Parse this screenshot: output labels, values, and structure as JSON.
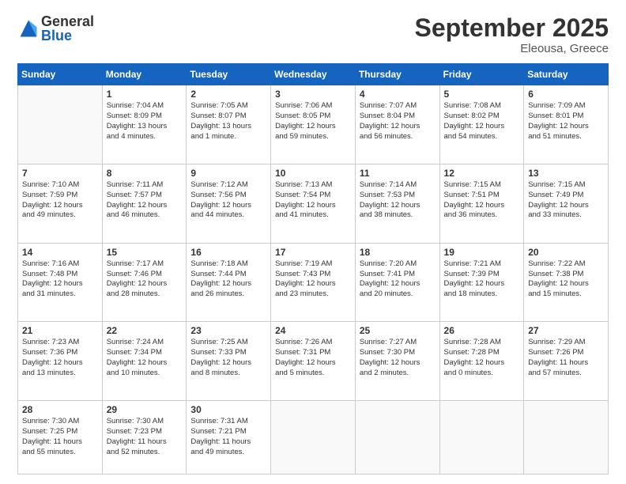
{
  "header": {
    "logo_general": "General",
    "logo_blue": "Blue",
    "month_title": "September 2025",
    "location": "Eleousa, Greece"
  },
  "weekdays": [
    "Sunday",
    "Monday",
    "Tuesday",
    "Wednesday",
    "Thursday",
    "Friday",
    "Saturday"
  ],
  "weeks": [
    [
      {
        "num": "",
        "info": ""
      },
      {
        "num": "1",
        "info": "Sunrise: 7:04 AM\nSunset: 8:09 PM\nDaylight: 13 hours\nand 4 minutes."
      },
      {
        "num": "2",
        "info": "Sunrise: 7:05 AM\nSunset: 8:07 PM\nDaylight: 13 hours\nand 1 minute."
      },
      {
        "num": "3",
        "info": "Sunrise: 7:06 AM\nSunset: 8:05 PM\nDaylight: 12 hours\nand 59 minutes."
      },
      {
        "num": "4",
        "info": "Sunrise: 7:07 AM\nSunset: 8:04 PM\nDaylight: 12 hours\nand 56 minutes."
      },
      {
        "num": "5",
        "info": "Sunrise: 7:08 AM\nSunset: 8:02 PM\nDaylight: 12 hours\nand 54 minutes."
      },
      {
        "num": "6",
        "info": "Sunrise: 7:09 AM\nSunset: 8:01 PM\nDaylight: 12 hours\nand 51 minutes."
      }
    ],
    [
      {
        "num": "7",
        "info": "Sunrise: 7:10 AM\nSunset: 7:59 PM\nDaylight: 12 hours\nand 49 minutes."
      },
      {
        "num": "8",
        "info": "Sunrise: 7:11 AM\nSunset: 7:57 PM\nDaylight: 12 hours\nand 46 minutes."
      },
      {
        "num": "9",
        "info": "Sunrise: 7:12 AM\nSunset: 7:56 PM\nDaylight: 12 hours\nand 44 minutes."
      },
      {
        "num": "10",
        "info": "Sunrise: 7:13 AM\nSunset: 7:54 PM\nDaylight: 12 hours\nand 41 minutes."
      },
      {
        "num": "11",
        "info": "Sunrise: 7:14 AM\nSunset: 7:53 PM\nDaylight: 12 hours\nand 38 minutes."
      },
      {
        "num": "12",
        "info": "Sunrise: 7:15 AM\nSunset: 7:51 PM\nDaylight: 12 hours\nand 36 minutes."
      },
      {
        "num": "13",
        "info": "Sunrise: 7:15 AM\nSunset: 7:49 PM\nDaylight: 12 hours\nand 33 minutes."
      }
    ],
    [
      {
        "num": "14",
        "info": "Sunrise: 7:16 AM\nSunset: 7:48 PM\nDaylight: 12 hours\nand 31 minutes."
      },
      {
        "num": "15",
        "info": "Sunrise: 7:17 AM\nSunset: 7:46 PM\nDaylight: 12 hours\nand 28 minutes."
      },
      {
        "num": "16",
        "info": "Sunrise: 7:18 AM\nSunset: 7:44 PM\nDaylight: 12 hours\nand 26 minutes."
      },
      {
        "num": "17",
        "info": "Sunrise: 7:19 AM\nSunset: 7:43 PM\nDaylight: 12 hours\nand 23 minutes."
      },
      {
        "num": "18",
        "info": "Sunrise: 7:20 AM\nSunset: 7:41 PM\nDaylight: 12 hours\nand 20 minutes."
      },
      {
        "num": "19",
        "info": "Sunrise: 7:21 AM\nSunset: 7:39 PM\nDaylight: 12 hours\nand 18 minutes."
      },
      {
        "num": "20",
        "info": "Sunrise: 7:22 AM\nSunset: 7:38 PM\nDaylight: 12 hours\nand 15 minutes."
      }
    ],
    [
      {
        "num": "21",
        "info": "Sunrise: 7:23 AM\nSunset: 7:36 PM\nDaylight: 12 hours\nand 13 minutes."
      },
      {
        "num": "22",
        "info": "Sunrise: 7:24 AM\nSunset: 7:34 PM\nDaylight: 12 hours\nand 10 minutes."
      },
      {
        "num": "23",
        "info": "Sunrise: 7:25 AM\nSunset: 7:33 PM\nDaylight: 12 hours\nand 8 minutes."
      },
      {
        "num": "24",
        "info": "Sunrise: 7:26 AM\nSunset: 7:31 PM\nDaylight: 12 hours\nand 5 minutes."
      },
      {
        "num": "25",
        "info": "Sunrise: 7:27 AM\nSunset: 7:30 PM\nDaylight: 12 hours\nand 2 minutes."
      },
      {
        "num": "26",
        "info": "Sunrise: 7:28 AM\nSunset: 7:28 PM\nDaylight: 12 hours\nand 0 minutes."
      },
      {
        "num": "27",
        "info": "Sunrise: 7:29 AM\nSunset: 7:26 PM\nDaylight: 11 hours\nand 57 minutes."
      }
    ],
    [
      {
        "num": "28",
        "info": "Sunrise: 7:30 AM\nSunset: 7:25 PM\nDaylight: 11 hours\nand 55 minutes."
      },
      {
        "num": "29",
        "info": "Sunrise: 7:30 AM\nSunset: 7:23 PM\nDaylight: 11 hours\nand 52 minutes."
      },
      {
        "num": "30",
        "info": "Sunrise: 7:31 AM\nSunset: 7:21 PM\nDaylight: 11 hours\nand 49 minutes."
      },
      {
        "num": "",
        "info": ""
      },
      {
        "num": "",
        "info": ""
      },
      {
        "num": "",
        "info": ""
      },
      {
        "num": "",
        "info": ""
      }
    ]
  ]
}
